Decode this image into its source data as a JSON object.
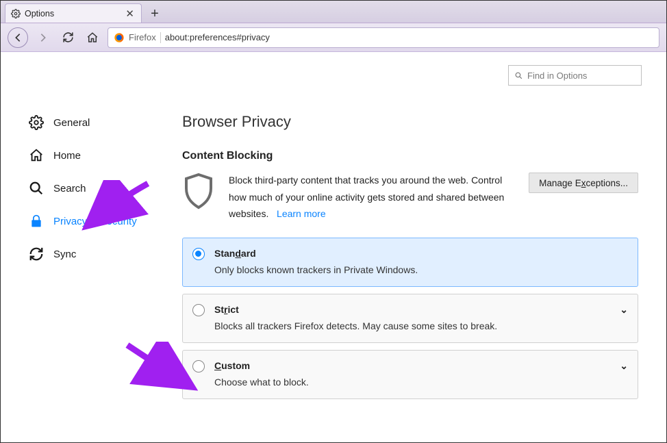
{
  "tab": {
    "title": "Options"
  },
  "urlbar": {
    "brand": "Firefox",
    "url": "about:preferences#privacy"
  },
  "search": {
    "placeholder": "Find in Options"
  },
  "sidebar": {
    "items": [
      {
        "label": "General"
      },
      {
        "label": "Home"
      },
      {
        "label": "Search"
      },
      {
        "label": "Privacy & Security"
      },
      {
        "label": "Sync"
      }
    ],
    "activeIndex": 3
  },
  "main": {
    "sectionTitle": "Browser Privacy",
    "subTitle": "Content Blocking",
    "description": "Block third-party content that tracks you around the web. Control how much of your online activity gets stored and shared between websites.",
    "learnMore": "Learn more",
    "exceptionsBtnPrefix": "Manage E",
    "exceptionsBtnU": "x",
    "exceptionsBtnSuffix": "ceptions...",
    "options": [
      {
        "titlePre": "Stan",
        "titleU": "d",
        "titlePost": "ard",
        "desc": "Only blocks known trackers in Private Windows.",
        "selected": true,
        "expandable": false
      },
      {
        "titlePre": "St",
        "titleU": "r",
        "titlePost": "ict",
        "desc": "Blocks all trackers Firefox detects. May cause some sites to break.",
        "selected": false,
        "expandable": true
      },
      {
        "titlePre": "",
        "titleU": "C",
        "titlePost": "ustom",
        "desc": "Choose what to block.",
        "selected": false,
        "expandable": true
      }
    ]
  }
}
